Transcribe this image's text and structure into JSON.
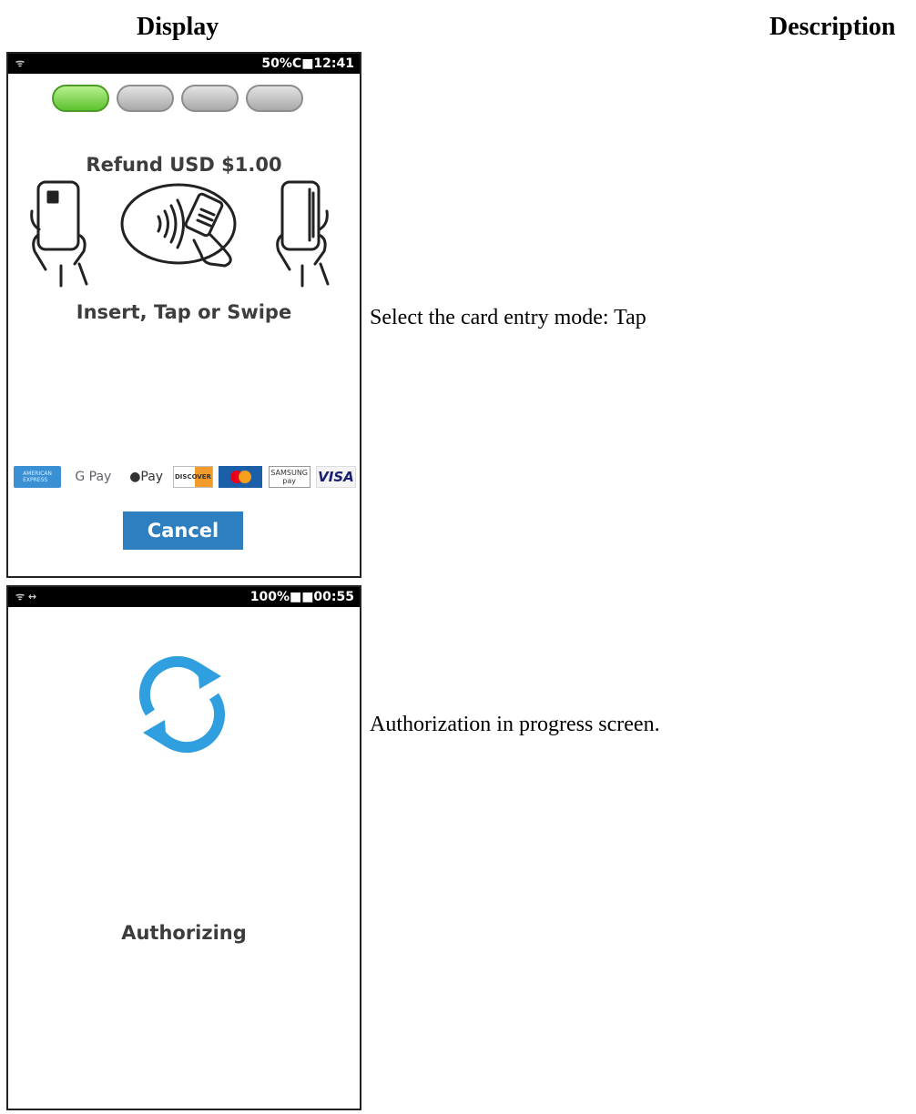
{
  "headers": {
    "display": "Display",
    "description": "Description"
  },
  "rows": [
    {
      "screen": {
        "status_time": "50%C■12:41",
        "refund_title": "Refund USD $1.00",
        "entry_prompt": "Insert, Tap or Swipe",
        "progress_steps": {
          "total": 4,
          "active": 1
        },
        "payment_logos": [
          "amex-logo",
          "google-pay-logo",
          "apple-pay-logo",
          "discover-logo",
          "mastercard-logo",
          "samsung-pay-logo",
          "visa-logo"
        ],
        "logo_text": {
          "gpay": "G Pay",
          "apay": "Pay",
          "discover": "DISCOVER",
          "samsung_top": "SAMSUNG",
          "samsung_bottom": "pay",
          "visa": "VISA"
        },
        "cancel_label": "Cancel"
      },
      "description": "Select the card entry mode: Tap"
    },
    {
      "screen": {
        "status_time": "100%■■00:55",
        "status_icons": "ᯤ ↔",
        "message": "Authorizing",
        "spinner_color": "#2f9fe0"
      },
      "description": "Authorization in progress screen."
    }
  ],
  "colors": {
    "progress_active": "#5cc22f",
    "button": "#2e7fbf"
  }
}
